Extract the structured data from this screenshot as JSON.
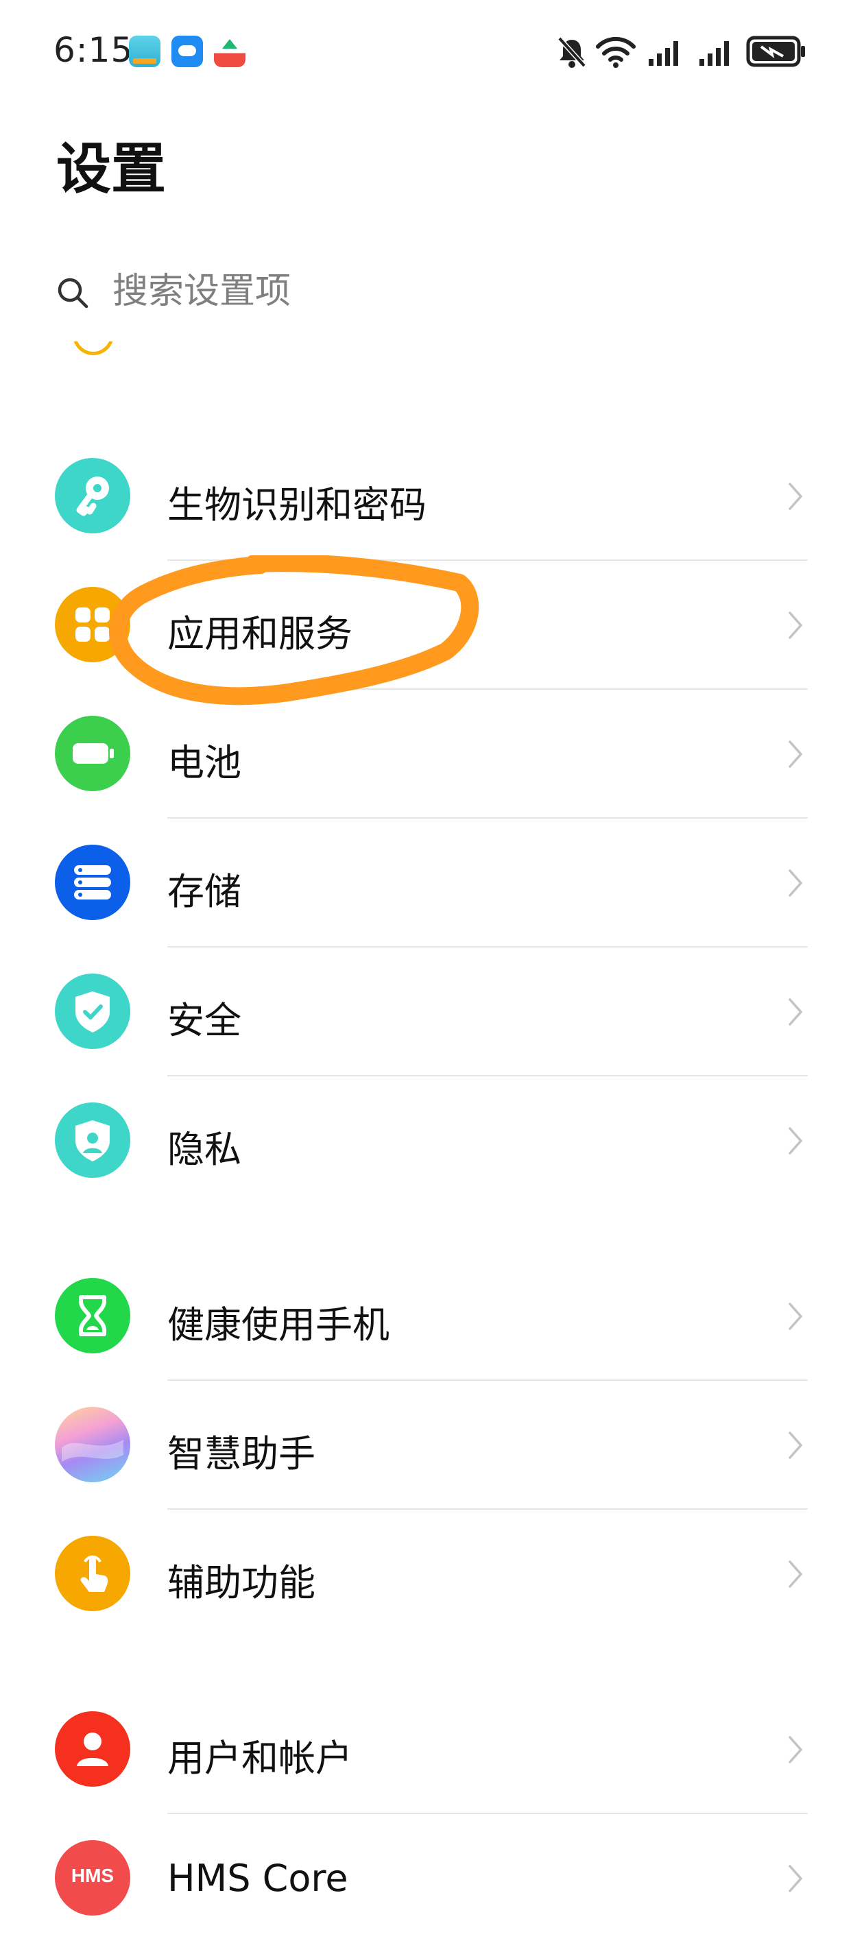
{
  "status_bar": {
    "time": "6:15",
    "notification_icons": [
      "weather-app-icon",
      "cloud-app-icon",
      "home-app-icon"
    ],
    "right_icons": [
      "mute-bell-icon",
      "wifi-icon",
      "signal-icon",
      "signal-icon",
      "battery-charging-icon"
    ]
  },
  "header": {
    "title": "设置"
  },
  "search": {
    "placeholder": "搜索设置项"
  },
  "settings_items": [
    {
      "label": "生物识别和密码",
      "icon": "key-icon",
      "color": "#3ed6c8"
    },
    {
      "label": "应用和服务",
      "icon": "apps-icon",
      "color": "#f7a800"
    },
    {
      "label": "电池",
      "icon": "battery-icon",
      "color": "#3ccf4e"
    },
    {
      "label": "存储",
      "icon": "storage-icon",
      "color": "#0b5fe8"
    },
    {
      "label": "安全",
      "icon": "shield-check-icon",
      "color": "#3ed6c8"
    },
    {
      "label": "隐私",
      "icon": "privacy-shield-icon",
      "color": "#3ed6c8"
    },
    {
      "label": "健康使用手机",
      "icon": "hourglass-icon",
      "color": "#22d84a"
    },
    {
      "label": "智慧助手",
      "icon": "assistant-orb-icon",
      "color": "#b18cf0"
    },
    {
      "label": "辅助功能",
      "icon": "hand-touch-icon",
      "color": "#f7a800"
    },
    {
      "label": "用户和帐户",
      "icon": "user-icon",
      "color": "#f5301e"
    },
    {
      "label": "HMS Core",
      "icon": "hms-core-icon",
      "color": "#f24b4b",
      "icon_text": "HMS"
    }
  ],
  "annotation": {
    "color": "#ff9a1f",
    "target": "应用和服务"
  }
}
